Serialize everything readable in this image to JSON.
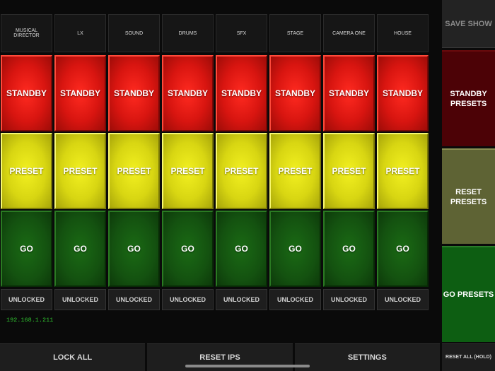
{
  "channels": [
    {
      "name": "MUSICAL DIRECTOR",
      "lock": "UNLOCKED"
    },
    {
      "name": "LX",
      "lock": "UNLOCKED"
    },
    {
      "name": "SOUND",
      "lock": "UNLOCKED"
    },
    {
      "name": "DRUMS",
      "lock": "UNLOCKED"
    },
    {
      "name": "SFX",
      "lock": "UNLOCKED"
    },
    {
      "name": "STAGE",
      "lock": "UNLOCKED"
    },
    {
      "name": "CAMERA ONE",
      "lock": "UNLOCKED"
    },
    {
      "name": "HOUSE",
      "lock": "UNLOCKED"
    }
  ],
  "cue_labels": {
    "standby": "STANDBY",
    "preset": "PRESET",
    "go": "GO"
  },
  "ip_address": "192.168.1.211",
  "side": {
    "save_show": "SAVE SHOW",
    "standby_presets": "STANDBY PRESETS",
    "reset_presets": "RESET PRESETS",
    "go_presets": "GO PRESETS",
    "reset_all": "RESET ALL (HOLD)"
  },
  "bottom": {
    "lock_all": "LOCK ALL",
    "reset_ips": "RESET IPS",
    "settings": "SETTINGS"
  },
  "colors": {
    "standby": "#d81510",
    "preset": "#d8d612",
    "go": "#145210",
    "ip_text": "#30c030"
  }
}
